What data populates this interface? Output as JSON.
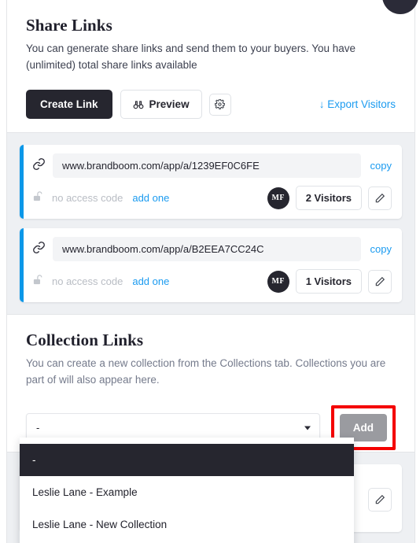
{
  "share": {
    "title": "Share Links",
    "description": "You can generate share links and send them to your buyers. You have (unlimited) total share links available",
    "create_label": "Create Link",
    "preview_label": "Preview",
    "preview_icon": "binoculars-icon",
    "settings_icon": "gear-icon",
    "export_label": "Export Visitors",
    "export_icon": "download-arrow-icon",
    "links": [
      {
        "url": "www.brandboom.com/app/a/1239EF0C6FE",
        "copy_label": "copy",
        "access_code_text": "no access code",
        "add_code_label": "add one",
        "avatar_initials": "MF",
        "visitors_label": "2 Visitors",
        "link_icon": "chain-link-icon",
        "lock_icon": "unlocked-padlock-icon",
        "edit_icon": "pencil-icon"
      },
      {
        "url": "www.brandboom.com/app/a/B2EEA7CC24C",
        "copy_label": "copy",
        "access_code_text": "no access code",
        "add_code_label": "add one",
        "avatar_initials": "MF",
        "visitors_label": "1 Visitors",
        "link_icon": "chain-link-icon",
        "lock_icon": "unlocked-padlock-icon",
        "edit_icon": "pencil-icon"
      }
    ]
  },
  "collection": {
    "title": "Collection Links",
    "description": "You can create a new collection from the Collections tab. Collections you are part of will also appear here.",
    "select_value": "-",
    "add_label": "Add",
    "options": [
      "-",
      "Leslie Lane - Example",
      "Leslie Lane - New Collection"
    ],
    "edit_icon": "pencil-icon"
  },
  "colors": {
    "accent_blue": "#0b97e8",
    "link_blue": "#1b9bf0",
    "dark": "#26262f",
    "panel_bg": "#eef0f3",
    "add_button_gray": "#9a9ba0",
    "highlight_red": "#f40000"
  }
}
